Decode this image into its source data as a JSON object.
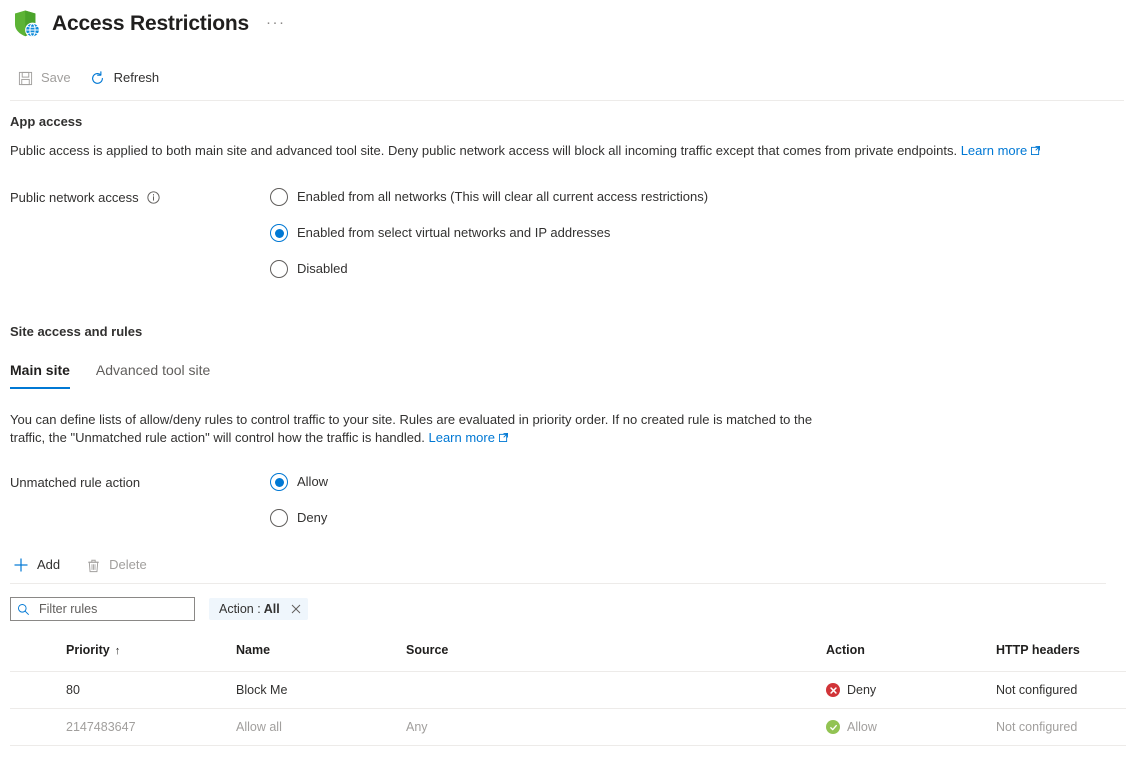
{
  "header": {
    "title": "Access Restrictions",
    "icon": "shield-globe-icon",
    "more_label": "···"
  },
  "command_bar": {
    "save_label": "Save",
    "refresh_label": "Refresh"
  },
  "app_access": {
    "section_title": "App access",
    "description": "Public access is applied to both main site and advanced tool site. Deny public network access will block all incoming traffic except that comes from private endpoints.",
    "learn_more_label": "Learn more",
    "field_label": "Public network access",
    "options": [
      {
        "label": "Enabled from all networks (This will clear all current access restrictions)",
        "selected": false
      },
      {
        "label": "Enabled from select virtual networks and IP addresses",
        "selected": true
      },
      {
        "label": "Disabled",
        "selected": false
      }
    ]
  },
  "site_access": {
    "section_title": "Site access and rules",
    "tabs": [
      {
        "label": "Main site",
        "active": true
      },
      {
        "label": "Advanced tool site",
        "active": false
      }
    ],
    "description": "You can define lists of allow/deny rules to control traffic to your site. Rules are evaluated in priority order. If no created rule is matched to the traffic, the \"Unmatched rule action\" will control how the traffic is handled.",
    "learn_more_label": "Learn more",
    "unmatched_label": "Unmatched rule action",
    "unmatched_options": [
      {
        "label": "Allow",
        "selected": true
      },
      {
        "label": "Deny",
        "selected": false
      }
    ]
  },
  "rules_toolbar": {
    "add_label": "Add",
    "delete_label": "Delete"
  },
  "filter_bar": {
    "placeholder": "Filter rules",
    "value": "",
    "pill_prefix": "Action :",
    "pill_value": "All",
    "pill_close_label": "✕"
  },
  "rules_table": {
    "columns": [
      "Priority",
      "Name",
      "Source",
      "Action",
      "HTTP headers"
    ],
    "sort_column": "Priority",
    "sort_arrow": "↑",
    "rows": [
      {
        "priority": "80",
        "name": "Block Me",
        "source": "",
        "action": "Deny",
        "action_kind": "deny",
        "http_headers": "Not configured",
        "dimmed": false
      },
      {
        "priority": "2147483647",
        "name": "Allow all",
        "source": "Any",
        "action": "Allow",
        "action_kind": "allow",
        "http_headers": "Not configured",
        "dimmed": true
      }
    ]
  },
  "colors": {
    "accent": "#0078d4",
    "deny": "#d13438",
    "allow": "#92c353",
    "shield": "#5cb335",
    "globe": "#0f8bd9"
  }
}
